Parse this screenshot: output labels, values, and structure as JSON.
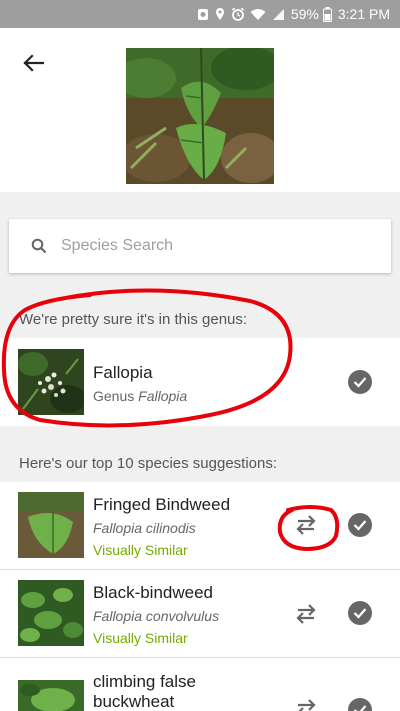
{
  "status_bar": {
    "battery": "59%",
    "time": "3:21 PM"
  },
  "search": {
    "placeholder": "Species Search"
  },
  "genus_section": {
    "label": "We're pretty sure it's in this genus:",
    "name": "Fallopia",
    "rank": "Genus",
    "genus_italic": "Fallopia"
  },
  "suggestions_section": {
    "label": "Here's our top 10 species suggestions:",
    "items": [
      {
        "common": "Fringed Bindweed",
        "scientific": "Fallopia cilinodis",
        "tag": "Visually Similar"
      },
      {
        "common": "Black-bindweed",
        "scientific": "Fallopia convolvulus",
        "tag": "Visually Similar"
      },
      {
        "common": "climbing false buckwheat",
        "scientific": "",
        "tag": ""
      }
    ]
  },
  "colors": {
    "similar_tag": "#74ac00",
    "annotation": "#e8000b"
  },
  "icons": [
    "back-arrow-icon",
    "search-icon",
    "checkmark-icon",
    "compare-arrows-icon"
  ]
}
